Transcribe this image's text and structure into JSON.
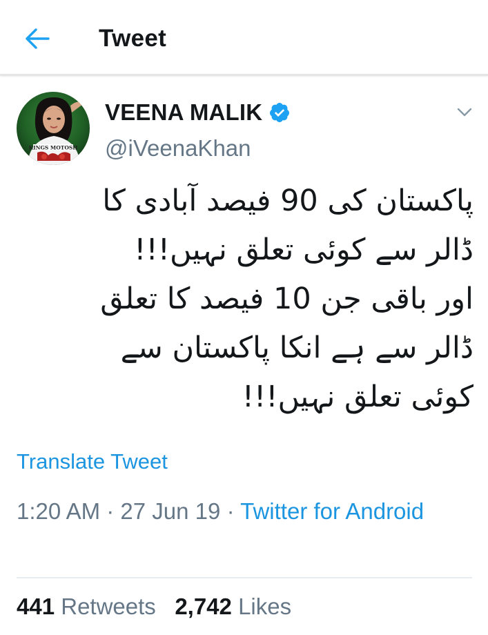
{
  "header": {
    "title": "Tweet",
    "back_icon": "arrow-left-icon"
  },
  "tweet": {
    "author": {
      "display_name": "VEENA MALIK",
      "handle": "@iVeenaKhan",
      "verified": true,
      "avatar_shirt_text": "KINGS MOTOSH"
    },
    "text_lines": [
      "پاکستان کی 90 فیصد آبادی کا",
      "ڈالر سے کوئی تعلق نہیں!!!",
      "اور باقی جن 10 فیصد کا تعلق",
      "ڈالر سے ہے انکا پاکستان سے",
      "کوئی تعلق نہیں!!!"
    ],
    "translate_label": "Translate Tweet",
    "time": "1:20 AM",
    "date": "27 Jun 19",
    "separator": "·",
    "source": "Twitter for Android",
    "retweets_count": "441",
    "retweets_label": "Retweets",
    "likes_count": "2,742",
    "likes_label": "Likes"
  },
  "colors": {
    "accent": "#1b95e0",
    "text": "#14171a",
    "secondary": "#657786",
    "verified_badge": "#1da1f2"
  }
}
